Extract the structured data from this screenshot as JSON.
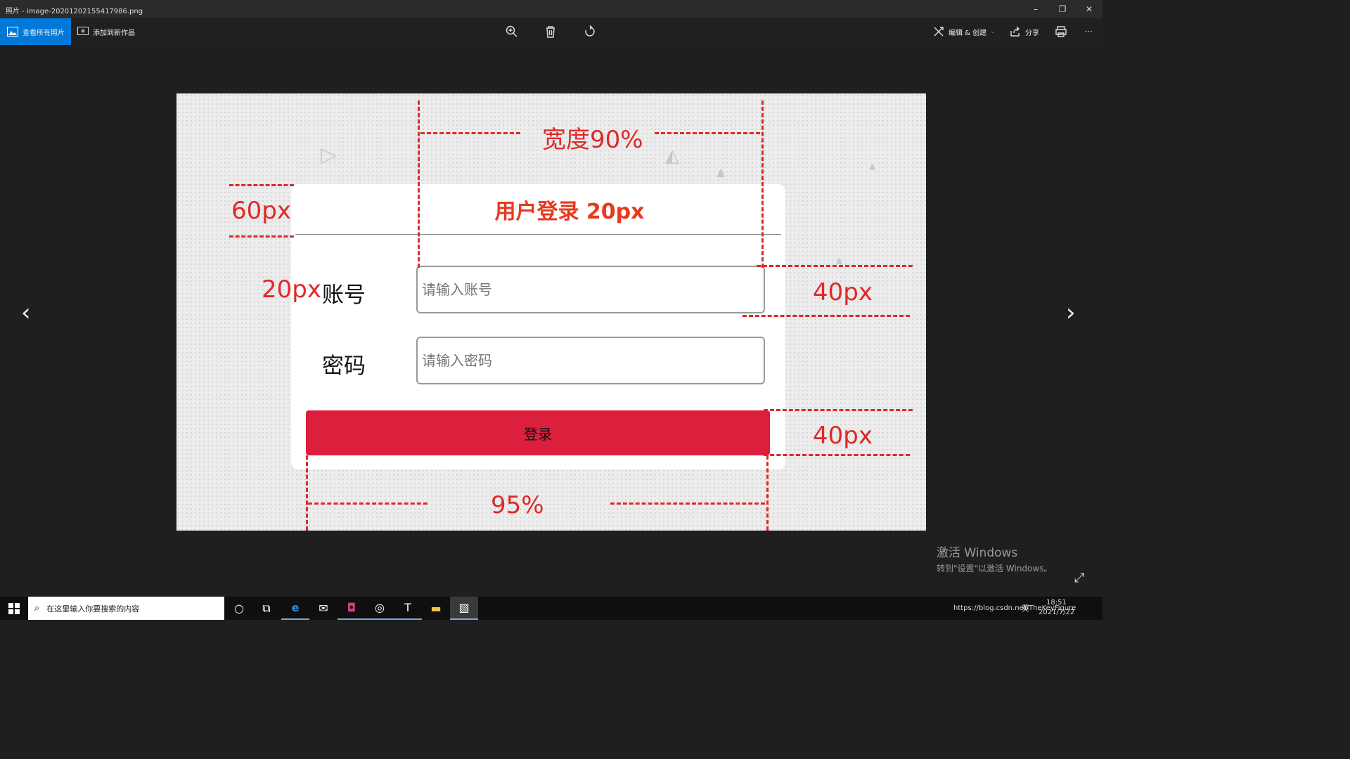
{
  "window": {
    "title": "照片 - image-20201202155417986.png",
    "minimize": "–",
    "restore": "❐",
    "close": "✕"
  },
  "toolbar": {
    "view_all": "查看所有照片",
    "add_to_creation": "添加到新作品",
    "edit_create": "编辑 & 创建",
    "share": "分享",
    "more": "···"
  },
  "nav": {
    "prev": "‹",
    "next": "›"
  },
  "image": {
    "card_title": "用户登录 20px",
    "account_label": "账号",
    "password_label": "密码",
    "account_placeholder": "请输入账号",
    "password_placeholder": "请输入密码",
    "login_button": "登录",
    "annotations": {
      "width90": "宽度90%",
      "h60": "60px",
      "pad20": "20px",
      "h40a": "40px",
      "h40b": "40px",
      "w95": "95%"
    }
  },
  "watermark": {
    "line1": "激活 Windows",
    "line2": "转到\"设置\"以激活 Windows。"
  },
  "taskbar": {
    "search_placeholder": "在这里输入你要搜索的内容",
    "time": "18:51",
    "date": "2021/7/22",
    "lang": "英",
    "url_overlay": "https://blog.csdn.net/TheKeyFigure"
  },
  "colors": {
    "annotation": "#dd2a28",
    "title_red": "#e8391f",
    "button_red": "#dc1f3c",
    "accent_blue": "#0078d7"
  }
}
